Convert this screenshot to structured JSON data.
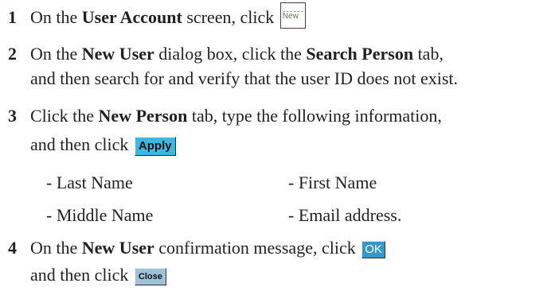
{
  "steps": [
    {
      "num": "1",
      "l1a": "On the ",
      "l1b": "User Account",
      "l1c": " screen, click",
      "button": "New"
    },
    {
      "num": "2",
      "l1a": "On the ",
      "l1b": "New User",
      "l1c": " dialog box, click the ",
      "l1d": "Search Person",
      "l1e": " tab,",
      "l2": "and then search for and verify that the user ID does not exist."
    },
    {
      "num": "3",
      "l1a": "Click the ",
      "l1b": "New Person",
      "l1c": " tab, type the following information,",
      "l2": "and then click",
      "button": "Apply",
      "fields": [
        "- Last Name",
        "- First Name",
        "- Middle Name",
        "- Email address."
      ]
    },
    {
      "num": "4",
      "l1a": "On the ",
      "l1b": "New User",
      "l1c": " confirmation message, click",
      "button1": "OK",
      "l2": "and then click",
      "button2": "Close"
    }
  ]
}
